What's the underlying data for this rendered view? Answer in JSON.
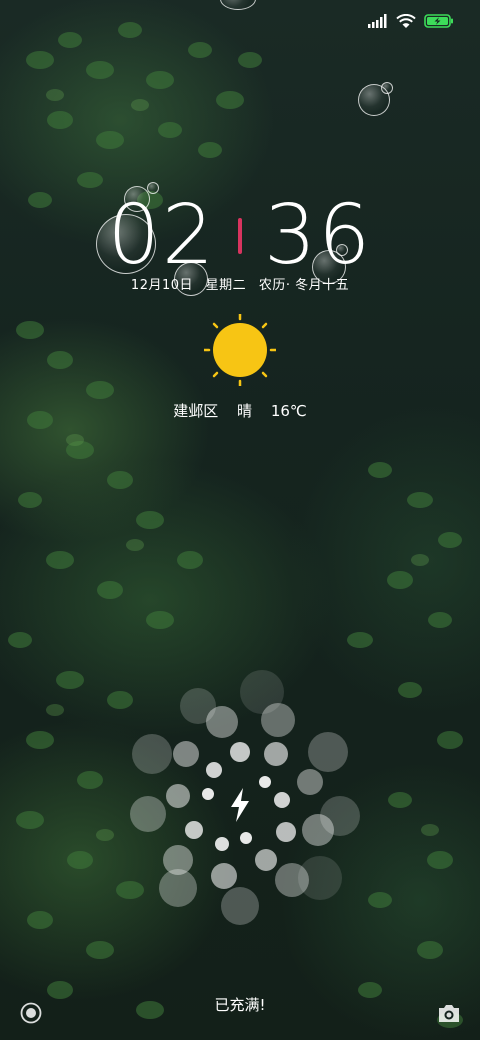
{
  "status_bar": {
    "signal_icon": "signal-bars-icon",
    "wifi_icon": "wifi-icon",
    "battery_icon": "battery-charging-icon",
    "battery_color": "#3ddc5a"
  },
  "clock": {
    "hours": "02",
    "minutes": "36",
    "separator_color": "#d8345f"
  },
  "date": {
    "day": "12月10日",
    "weekday": "星期二",
    "lunar": "农历· 冬月十五"
  },
  "weather": {
    "icon": "sun-icon",
    "icon_color": "#f7c514",
    "location": "建邺区",
    "condition": "晴",
    "temperature": "16℃"
  },
  "charging": {
    "icon": "lightning-bolt-icon",
    "status": "已充满!"
  },
  "shortcuts": {
    "left_icon": "assistant-circle-icon",
    "right_icon": "camera-icon"
  }
}
